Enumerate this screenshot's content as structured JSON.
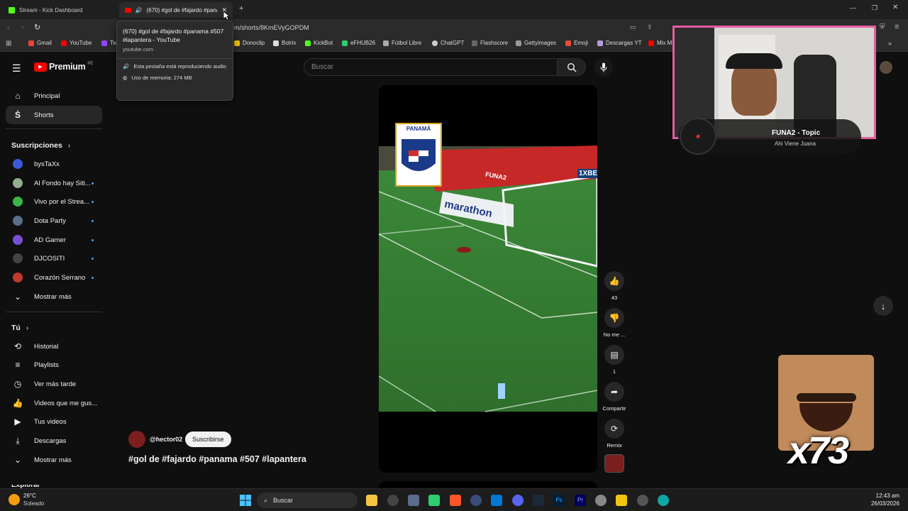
{
  "browser": {
    "tabs": [
      {
        "title": "Stream - Kick Dashboard"
      },
      {
        "title": "(670) #gol de #fajardo #pana"
      }
    ],
    "new_tab_symbol": "+",
    "url": "m/shorts/8KmEVyGOPDM",
    "bookmarks": [
      "Gmail",
      "YouTube",
      "Tw",
      "Donoclip",
      "Botrix",
      "KickBot",
      "eFHUB26",
      "Fútbol Libre",
      "ChatGPT",
      "Flashscore",
      "Gettyimages",
      "Emoji",
      "Descargas YT",
      "Mix M"
    ],
    "colors": {
      "kick": "#53fc18",
      "youtube": "#ff0000"
    }
  },
  "tooltip": {
    "title": "(670) #gol de #fajardo #panama #507 #lapantera - YouTube",
    "domain": "youtube.com",
    "audio_text": "Esta pestaña está reproduciendo audio",
    "memory_text": "Uso de memoria: 274 MB"
  },
  "yt": {
    "logo_text": "Premium",
    "logo_region": "PE",
    "search_placeholder": "Buscar",
    "nav": [
      {
        "label": "Principal"
      },
      {
        "label": "Shorts"
      }
    ],
    "subs_title": "Suscripciones",
    "subs": [
      {
        "label": "bysTaXx",
        "dot": false,
        "color": "#3a5ad9"
      },
      {
        "label": "Al Fondo hay Siti...",
        "dot": true,
        "color": "#8fb08a"
      },
      {
        "label": "Vivo por el Strea...",
        "dot": true,
        "color": "#3bb54a"
      },
      {
        "label": "Dota Party",
        "dot": true,
        "color": "#5c6e8c"
      },
      {
        "label": "AD Gamer",
        "dot": true,
        "color": "#7a4fd6"
      },
      {
        "label": "DJCOSITI",
        "dot": true,
        "color": "#444"
      },
      {
        "label": "Corazón Serrano",
        "dot": true,
        "color": "#c0392b"
      },
      {
        "label": "Mostrar más",
        "dot": false
      }
    ],
    "you_title": "Tú",
    "you": [
      {
        "label": "Historial"
      },
      {
        "label": "Playlists"
      },
      {
        "label": "Ver más tarde"
      },
      {
        "label": "Videos que me gus..."
      },
      {
        "label": "Tus videos"
      },
      {
        "label": "Descargas"
      },
      {
        "label": "Mostrar más"
      }
    ],
    "explore_cut": "Explorar"
  },
  "short": {
    "crest_text": "PANAMÁ",
    "ad_boards": [
      "marathon",
      "FUNA2",
      "1XBE"
    ],
    "channel": "@hector02",
    "subscribe_label": "Suscribirse",
    "title": "#gol de #fajardo #panama #507 #lapantera",
    "like_count": "43",
    "dislike_label": "No me ...",
    "comment_count": "1",
    "share_label": "Compartir",
    "remix_label": "Remix"
  },
  "overlay": {
    "song": "FUNA2 - Topic",
    "artist": "Ahi Viene Juana",
    "badge": "x73",
    "webcam_border": "#e45da0"
  },
  "taskbar": {
    "weather_temp": "26°C",
    "weather_desc": "Soleado",
    "search_label": "Buscar",
    "time": "12:43 am",
    "date": "26/03/2026"
  }
}
